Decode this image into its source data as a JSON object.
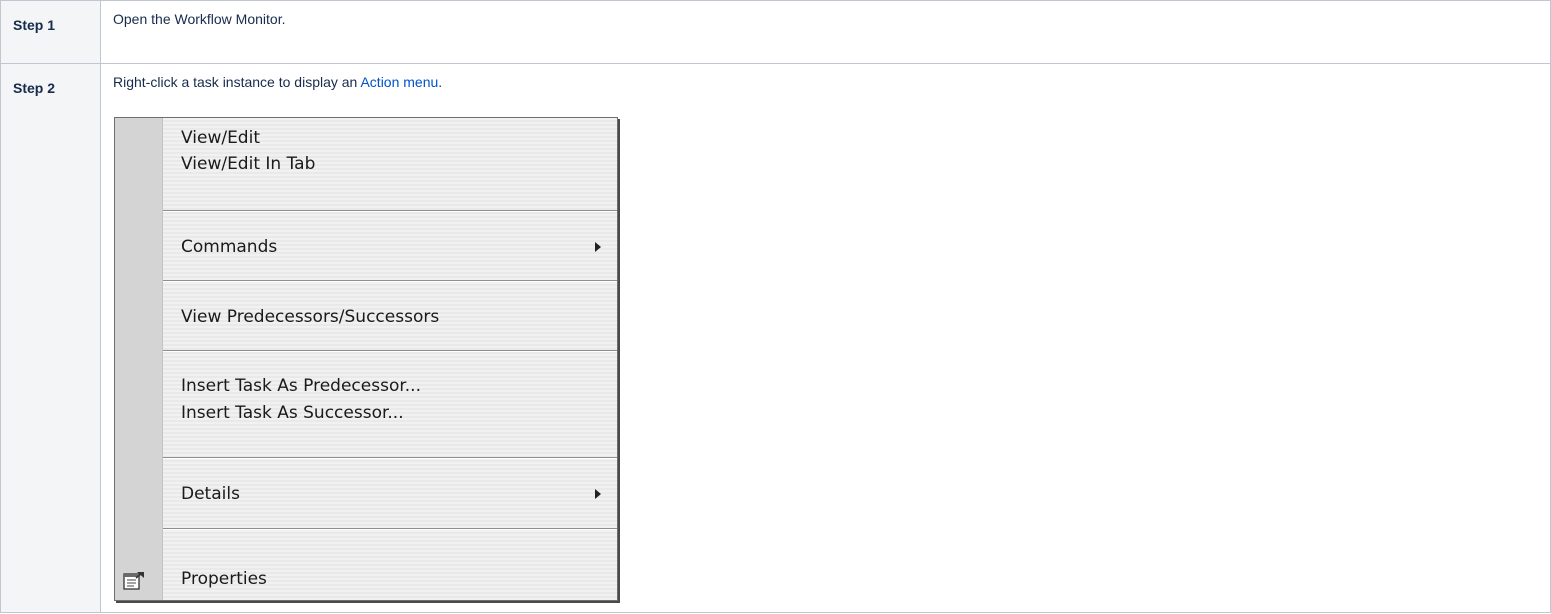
{
  "steps": [
    {
      "label": "Step 1",
      "text": "Open the Workflow Monitor."
    },
    {
      "label": "Step 2",
      "text_before": "Right-click a task instance to display an ",
      "link": "Action menu",
      "text_after": "."
    }
  ],
  "menu": {
    "items": [
      {
        "label": "View/Edit"
      },
      {
        "label": "View/Edit In Tab"
      },
      {
        "label": "Commands",
        "submenu": true
      },
      {
        "label": "View Predecessors/Successors"
      },
      {
        "label": "Insert Task As Predecessor..."
      },
      {
        "label": "Insert Task As Successor..."
      },
      {
        "label": "Details",
        "submenu": true
      },
      {
        "label": "Properties",
        "icon": "properties-icon"
      }
    ]
  },
  "colors": {
    "link": "#0052cc",
    "border": "#c1c7d0",
    "label_bg": "#f4f5f7"
  }
}
